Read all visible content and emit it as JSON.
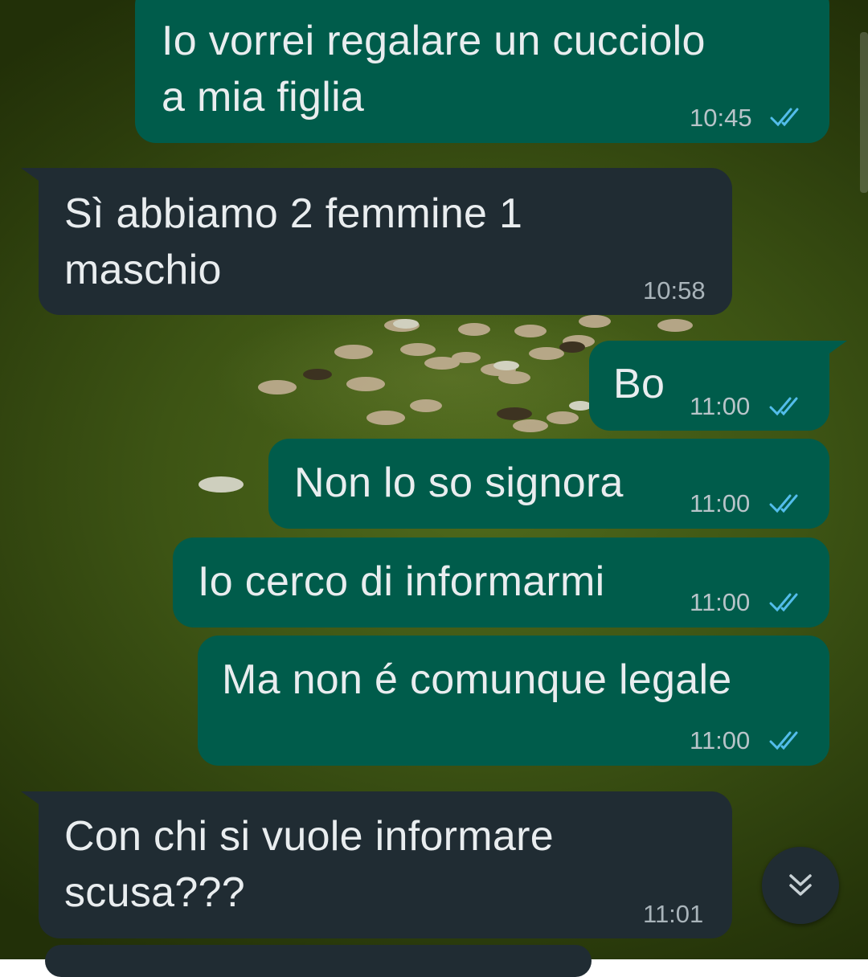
{
  "messages": [
    {
      "text_line1": "Io vorrei regalare un cucciolo",
      "text_line2": "a mia figlia",
      "time": "10:45",
      "direction": "outgoing",
      "status": "read"
    },
    {
      "text_line1": "Sì abbiamo 2 femmine 1",
      "text_line2": "maschio",
      "time": "10:58",
      "direction": "incoming"
    },
    {
      "text_line1": "Bo",
      "time": "11:00",
      "direction": "outgoing",
      "status": "read"
    },
    {
      "text_line1": "Non lo so signora",
      "time": "11:00",
      "direction": "outgoing",
      "status": "read"
    },
    {
      "text_line1": "Io cerco di informarmi",
      "time": "11:00",
      "direction": "outgoing",
      "status": "read"
    },
    {
      "text_line1": "Ma non é comunque legale",
      "time": "11:00",
      "direction": "outgoing",
      "status": "read"
    },
    {
      "text_line1": "Con chi si vuole informare",
      "text_line2": "scusa???",
      "time": "11:01",
      "direction": "incoming"
    }
  ],
  "icons": {
    "read_receipt": "double-check-icon",
    "scroll_down": "double-chevron-down-icon"
  },
  "colors": {
    "outgoing_bubble": "#005c4b",
    "incoming_bubble": "#202c33",
    "read_tick": "#53bdeb",
    "text": "#e9edef"
  }
}
